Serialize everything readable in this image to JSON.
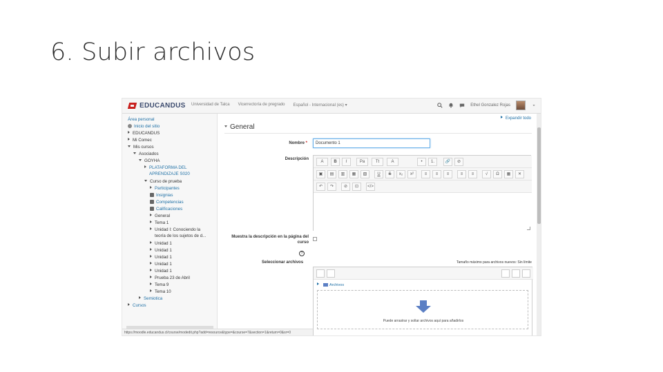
{
  "slide": {
    "title": "6. Subir archivos"
  },
  "topbar": {
    "brand": "EDUCANDUS",
    "links": [
      "Universidad de Talca",
      "Vicerrectoría de pregrado",
      "Español - Internacional (es) ▾"
    ],
    "user": "Ethel Gonzalez Rojas"
  },
  "sidebar": {
    "items": [
      "Área personal",
      "Inicio del sitio",
      "EDUCANDUS",
      "Mi Comec",
      "Mis cursos",
      "Asociados",
      "GOYHA",
      "PLATAFORMA DEL",
      "APRENDIZAJE S020",
      "Curso de prueba",
      "Participantes",
      "Insignias",
      "Competencias",
      "Calificaciones",
      "General",
      "Tema 1",
      "Unidad I: Conociendo la",
      "teoría de los sujetos de d...",
      "Unidad 1",
      "Unidad 1",
      "Unidad 1",
      "Unidad 1",
      "Unidad 1",
      "Prueba 23 de Abril",
      "Tema 9",
      "Tema 10",
      "Semiotica",
      "Cursos"
    ]
  },
  "status_url": "https://moodle.educandus.cl/course/modedit.php?add=resource&type=&course=7&section=1&return=0&sr=0",
  "main": {
    "expand_all": "Expandir todo",
    "section_title": "General",
    "name_label": "Nombre",
    "name_value": "Documento 1",
    "description_label": "Descripción",
    "show_description_label": "Muestra la descripción en la página del curso",
    "select_files_label": "Seleccionar archivos",
    "max_size_text": "Tamaño máximo para archivos nuevos: Sin límite",
    "folder_label": "Archivos",
    "drop_text": "Puede arrastrar y soltar archivos aquí para añadirlos"
  },
  "editor": {
    "row1": [
      "A",
      "B",
      "I",
      "Pa",
      "Tt",
      "A",
      "•",
      "1.",
      "🔗",
      "⊘"
    ],
    "row2": [
      "▣",
      "▤",
      "▥",
      "▦",
      "▧",
      "U",
      "S",
      "x₂",
      "x²",
      "≡",
      "≡",
      "≡",
      "≡",
      "≡",
      "√",
      "Ω",
      "▦",
      "✕"
    ],
    "row3": [
      "↶",
      "↷",
      "⊘",
      "⊡",
      "</>"
    ]
  },
  "colors": {
    "brand_red": "#c8201e",
    "link_blue": "#1d6fa5",
    "drop_arrow": "#5b7fc4"
  }
}
